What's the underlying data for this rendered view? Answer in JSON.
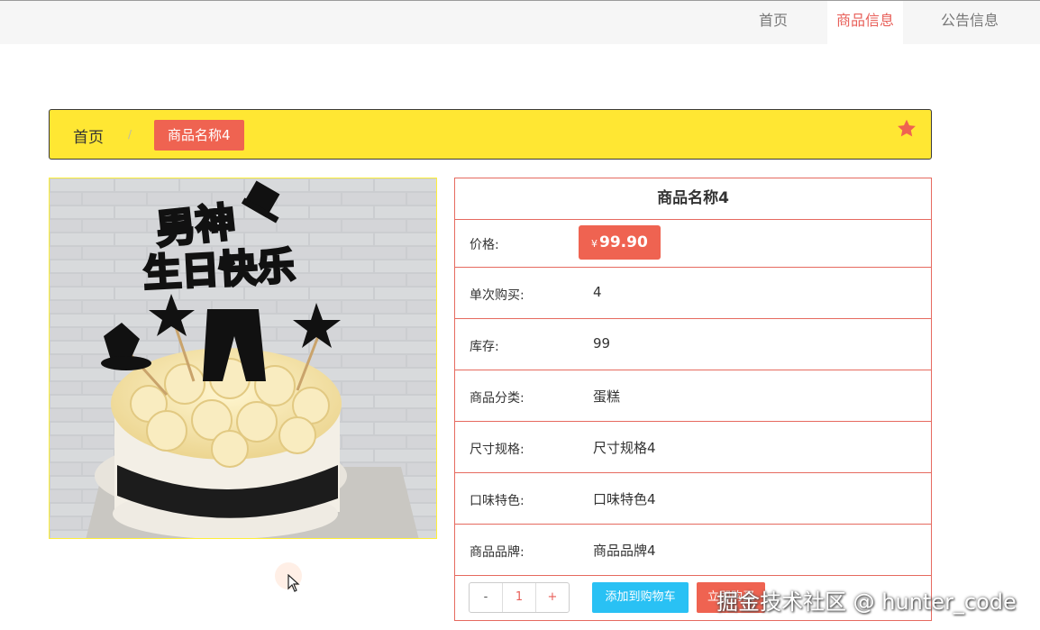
{
  "nav": {
    "items": [
      {
        "label": "首页"
      },
      {
        "label": "商品信息"
      },
      {
        "label": "公告信息"
      }
    ]
  },
  "breadcrumb": {
    "home": "首页",
    "separator": "/",
    "current": "商品名称4"
  },
  "product": {
    "title": "商品名称4",
    "price_currency": "¥",
    "price_value": "99.90",
    "fields": [
      {
        "label": "价格:",
        "value": ""
      },
      {
        "label": "单次购买:",
        "value": "4"
      },
      {
        "label": "库存:",
        "value": "99"
      },
      {
        "label": "商品分类:",
        "value": "蛋糕"
      },
      {
        "label": "尺寸规格:",
        "value": "尺寸规格4"
      },
      {
        "label": "口味特色:",
        "value": "口味特色4"
      },
      {
        "label": "商品品牌:",
        "value": "商品品牌4"
      }
    ],
    "image_text": {
      "line1": "男神",
      "line2": "生日快乐"
    }
  },
  "actions": {
    "minus": "-",
    "quantity": "1",
    "plus": "+",
    "add_to_cart": "添加到购物车",
    "buy_now": "立即购买"
  },
  "watermark": "掘金技术社区 @ hunter_code",
  "colors": {
    "accent_red": "#ef6351",
    "breadcrumb_yellow": "#ffe733",
    "cart_blue": "#29c1f4",
    "nav_active": "#e8605a"
  },
  "icons": {
    "favorite": "star-icon",
    "cursor": "mouse-pointer-icon"
  }
}
